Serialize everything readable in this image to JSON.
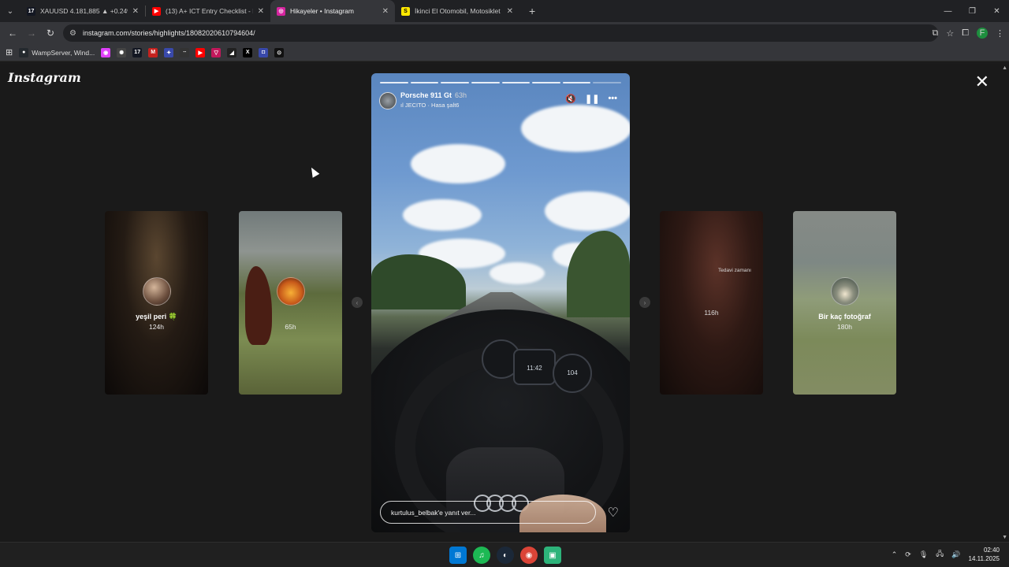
{
  "browser": {
    "tab_menu_icon": "chevron-down-icon",
    "tabs": [
      {
        "title": "XAUUSD 4.181,885 ▲ +0.24% ...",
        "favicon": "tradingview-icon",
        "favicon_text": "17",
        "favicon_color": "#131722"
      },
      {
        "title": "(13) A+ ICT Entry Checklist - ICT ...",
        "favicon": "youtube-icon",
        "favicon_text": "▶",
        "favicon_color": "#ff0000"
      },
      {
        "title": "Hikayeler • Instagram",
        "favicon": "instagram-icon",
        "favicon_text": "◎",
        "favicon_color": "#d6249f"
      },
      {
        "title": "İkinci El Otomobil, Motosiklet ...",
        "favicon": "sahibinden-icon",
        "favicon_text": "S",
        "favicon_color": "#ffe800"
      }
    ],
    "new_tab": "+",
    "url": "instagram.com/stories/highlights/18082020610794604/",
    "bookmarks": [
      {
        "label": "WampServer, Wind...",
        "icon": "github-icon",
        "color": "#24292e",
        "glyph": "●"
      },
      {
        "label": "",
        "icon": "app-icon-1",
        "color": "#e040fb",
        "glyph": "◉"
      },
      {
        "label": "",
        "icon": "openai-icon",
        "color": "#444",
        "glyph": "✺"
      },
      {
        "label": "",
        "icon": "tradingview-icon",
        "color": "#131722",
        "glyph": "17"
      },
      {
        "label": "",
        "icon": "gmail-icon",
        "color": "#c5221f",
        "glyph": "M"
      },
      {
        "label": "",
        "icon": "app-icon-2",
        "color": "#3949ab",
        "glyph": "✦"
      },
      {
        "label": "",
        "icon": "dots-icon",
        "color": "#333",
        "glyph": "∙∙"
      },
      {
        "label": "",
        "icon": "youtube-icon",
        "color": "#ff0000",
        "glyph": "▶"
      },
      {
        "label": "",
        "icon": "app-icon-3",
        "color": "#c2185b",
        "glyph": "▽"
      },
      {
        "label": "",
        "icon": "app-icon-4",
        "color": "#212121",
        "glyph": "◢"
      },
      {
        "label": "",
        "icon": "x-twitter-icon",
        "color": "#000000",
        "glyph": "𝕏"
      },
      {
        "label": "",
        "icon": "app-icon-5",
        "color": "#3949ab",
        "glyph": "◘"
      },
      {
        "label": "",
        "icon": "app-icon-6",
        "color": "#111111",
        "glyph": "⊙"
      }
    ]
  },
  "instagram": {
    "logo": "Instagram",
    "close_icon": "close-icon",
    "side_stories": [
      {
        "name": "yeşil peri 🍀",
        "time": "124h"
      },
      {
        "name": "",
        "time": "65h"
      },
      {
        "name": "",
        "time": "116h",
        "note": "Tedavi zamanı"
      },
      {
        "name": "Bir kaç fotoğraf",
        "time": "180h"
      }
    ],
    "active_story": {
      "title": "Porsche 911 Gt",
      "age": "63h",
      "music": "JECITO · Hasa şalt6",
      "segments": 8,
      "gauge_left": "",
      "gauge_mid": "11:42",
      "gauge_right": "104",
      "reply_placeholder": "kurtulus_belbak'e yanıt ver..."
    }
  },
  "taskbar": {
    "apps": [
      {
        "icon": "windows-start-icon",
        "color": "#0078d4",
        "glyph": "⊞"
      },
      {
        "icon": "spotify-icon",
        "color": "#1db954",
        "glyph": "♫"
      },
      {
        "icon": "steam-icon",
        "color": "#1b2838",
        "glyph": "◐"
      },
      {
        "icon": "chrome-icon",
        "color": "#db4437",
        "glyph": "◉"
      },
      {
        "icon": "app-icon-7",
        "color": "#2db37a",
        "glyph": "▣"
      }
    ],
    "time": "02:40",
    "date": "14.11.2025"
  }
}
